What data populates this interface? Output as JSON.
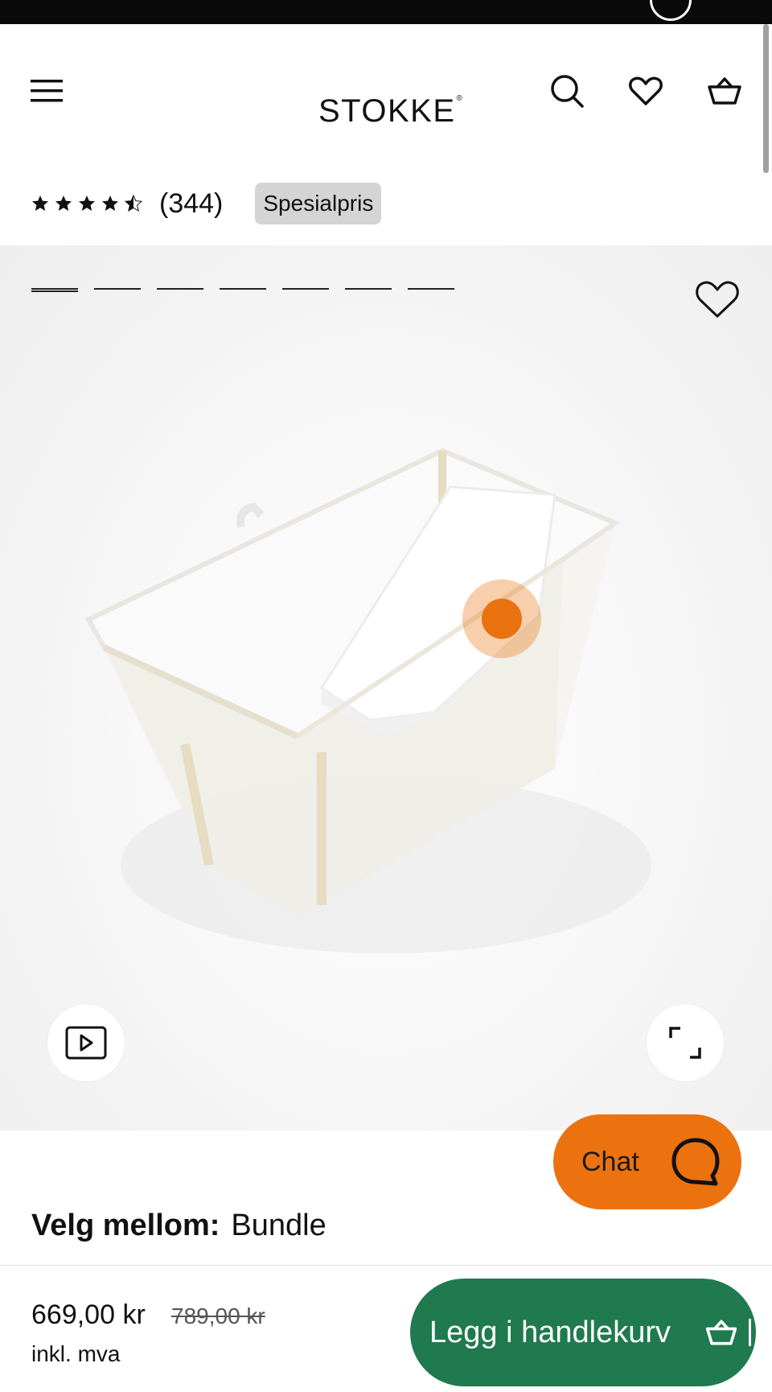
{
  "header": {
    "logo_text": "STOKKE",
    "logo_mark": "®"
  },
  "product": {
    "rating": 4.5,
    "rating_max": 5,
    "review_count": "(344)",
    "badge": "Spesialpris",
    "gallery_image_count": 7,
    "gallery_active_index": 0
  },
  "chat": {
    "label": "Chat"
  },
  "variant": {
    "label": "Velg mellom:",
    "value": "Bundle"
  },
  "purchase": {
    "price": "669,00 kr",
    "old_price": "789,00 kr",
    "vat_note": "inkl. mva",
    "add_to_cart_label": "Legg i handlekurv"
  },
  "colors": {
    "accent_orange": "#ec720f",
    "cart_green": "#1f7a4f",
    "badge_gray": "#d4d4d4"
  },
  "icons": [
    "menu-icon",
    "search-icon",
    "heart-icon",
    "basket-icon",
    "play-icon",
    "expand-icon",
    "chat-bubble-icon",
    "star-icon"
  ]
}
